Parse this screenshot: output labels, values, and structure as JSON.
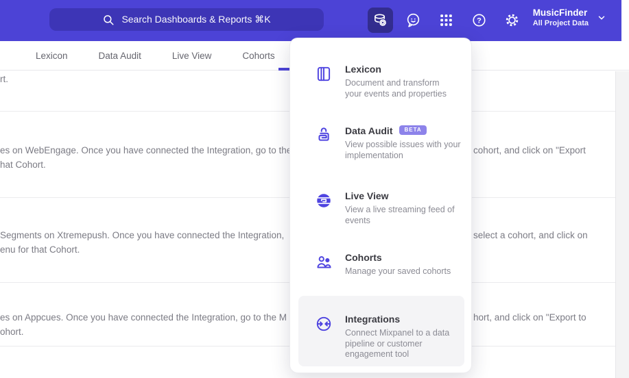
{
  "colors": {
    "accent": "#4c43d6",
    "panel_icon": "#4f44e0",
    "badge_bg": "#8d83ea"
  },
  "header": {
    "search_placeholder": "Search Dashboards & Reports ⌘K",
    "project_name": "MusicFinder",
    "project_subtitle": "All Project Data"
  },
  "nav_tabs": [
    {
      "label": "Lexicon"
    },
    {
      "label": "Data Audit"
    },
    {
      "label": "Live View"
    },
    {
      "label": "Cohorts"
    }
  ],
  "menu_items": [
    {
      "title": "Lexicon",
      "description": "Document and transform\nyour events and properties"
    },
    {
      "title": "Data Audit",
      "badge": "BETA",
      "description": "View possible issues with your\nimplementation"
    },
    {
      "title": "Live View",
      "description": "View a live streaming feed of\nevents"
    },
    {
      "title": "Cohorts",
      "description": "Manage your saved cohorts"
    },
    {
      "title": "Integrations",
      "description": "Connect Mixpanel to a data\npipeline or customer\nengagement tool"
    }
  ],
  "background_rows": [
    {
      "left_line1": "rt.",
      "left_line2": "",
      "right_line1": ""
    },
    {
      "left_line1": "es on WebEngage. Once you have connected the Integration, go to the",
      "right_line1": "cohort, and click on \"Export",
      "left_line2": "hat Cohort."
    },
    {
      "left_line1": "Segments on Xtremepush. Once you have connected the Integration,",
      "right_line1": "select a cohort, and click on",
      "left_line2": "enu for that Cohort."
    },
    {
      "left_line1": "es on Appcues. Once you have connected the Integration, go to the M",
      "right_line1": "hort, and click on \"Export to",
      "left_line2": "ohort."
    }
  ]
}
